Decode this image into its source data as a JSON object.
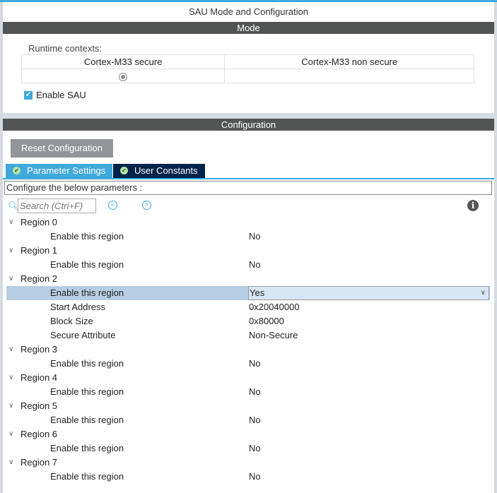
{
  "title": "SAU Mode and Configuration",
  "mode": {
    "header": "Mode",
    "runtime_label": "Runtime contexts:",
    "columns": [
      "Cortex-M33 secure",
      "Cortex-M33 non secure"
    ],
    "enable_sau": "Enable SAU",
    "enable_sau_checked": true
  },
  "config": {
    "header": "Configuration",
    "reset_label": "Reset Configuration",
    "tabs": [
      "Parameter Settings",
      "User Constants"
    ],
    "configure_label": "Configure the below parameters :",
    "search_placeholder": "Search (Ctrl+F)"
  },
  "regions": [
    {
      "name": "Region 0",
      "params": [
        [
          "Enable this region",
          "No"
        ]
      ]
    },
    {
      "name": "Region 1",
      "params": [
        [
          "Enable this region",
          "No"
        ]
      ]
    },
    {
      "name": "Region 2",
      "params": [
        [
          "Enable this region",
          "Yes"
        ],
        [
          "Start Address",
          "0x20040000"
        ],
        [
          "Block Size",
          "0x80000"
        ],
        [
          "Secure Attribute",
          "Non-Secure"
        ]
      ]
    },
    {
      "name": "Region 3",
      "params": [
        [
          "Enable this region",
          "No"
        ]
      ]
    },
    {
      "name": "Region 4",
      "params": [
        [
          "Enable this region",
          "No"
        ]
      ]
    },
    {
      "name": "Region 5",
      "params": [
        [
          "Enable this region",
          "No"
        ]
      ]
    },
    {
      "name": "Region 6",
      "params": [
        [
          "Enable this region",
          "No"
        ]
      ]
    },
    {
      "name": "Region 7",
      "params": [
        [
          "Enable this region",
          "No"
        ]
      ]
    }
  ]
}
